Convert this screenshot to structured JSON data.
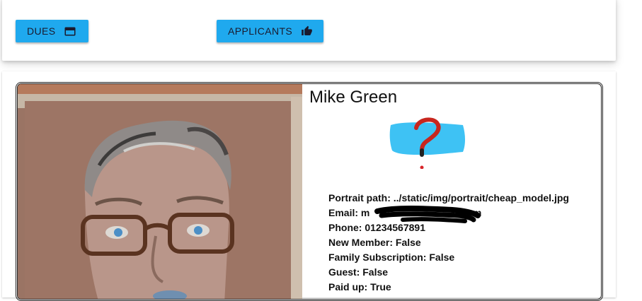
{
  "toolbar": {
    "dues_label": "DUES",
    "dues_icon": "credit-card-icon",
    "applicants_label": "APPLICANTS",
    "applicants_icon": "thumbs-up-icon",
    "button_color": "#1fa9ee"
  },
  "member": {
    "name": "Mike Green",
    "status_icon": "question-mark-icon",
    "details": [
      {
        "label": "Portrait path:",
        "value": "../static/img/portrait/cheap_model.jpg"
      },
      {
        "label": "Email:",
        "value": "m                              d.com"
      },
      {
        "label": "Phone:",
        "value": "01234567891"
      },
      {
        "label": "New Member:",
        "value": "False"
      },
      {
        "label": "Family Subscription:",
        "value": "False"
      },
      {
        "label": "Guest:",
        "value": "False"
      },
      {
        "label": "Paid up:",
        "value": "True"
      }
    ]
  }
}
